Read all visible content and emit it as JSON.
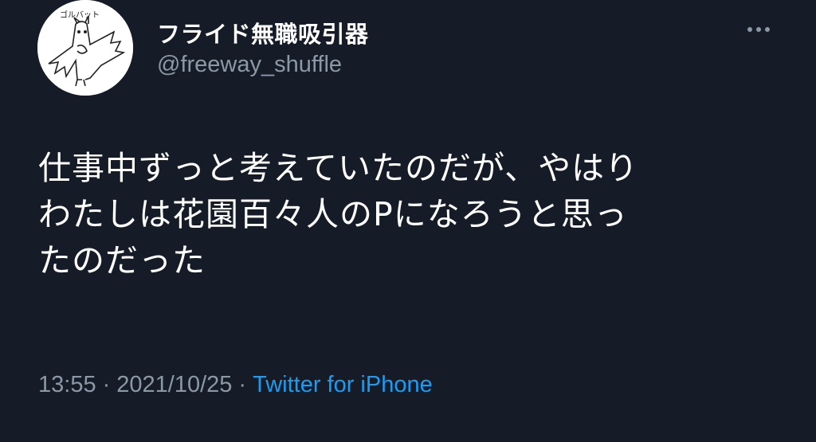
{
  "tweet": {
    "display_name": "フライド無職吸引器",
    "handle": "@freeway_shuffle",
    "avatar_icon": "bat-drawing-avatar-icon",
    "avatar_caption": "ゴルバット",
    "body_lines": [
      "仕事中ずっと考えていたのだが、やはり",
      "わたしは花園百々人のPになろうと思っ",
      "たのだった"
    ],
    "time": "13:55",
    "date": "2021/10/25",
    "separator": "·",
    "source": "Twitter for iPhone"
  },
  "colors": {
    "background": "#151c27",
    "text": "#ffffff",
    "secondary": "#8b98a5",
    "link": "#1d9bf0"
  }
}
